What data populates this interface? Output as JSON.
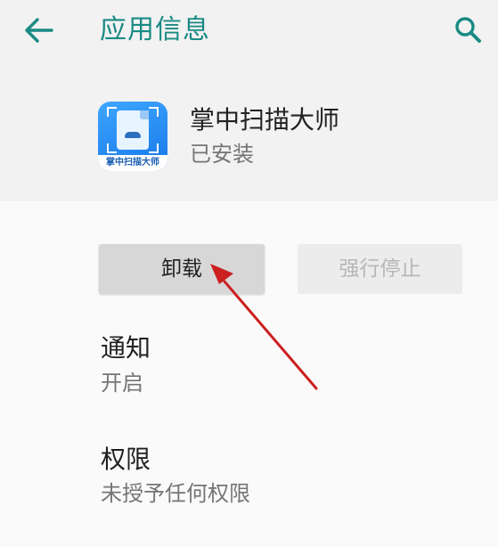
{
  "colors": {
    "accent": "#1a8a84",
    "annotation_arrow": "#cc1f1f"
  },
  "app_bar": {
    "back_icon": "arrow-left-icon",
    "title": "应用信息",
    "search_icon": "search-icon"
  },
  "app": {
    "name": "掌中扫描大师",
    "status": "已安装",
    "icon_caption": "掌中扫描大师"
  },
  "actions": {
    "uninstall_label": "卸载",
    "force_stop_label": "强行停止"
  },
  "settings": {
    "notifications": {
      "title": "通知",
      "value": "开启"
    },
    "permissions": {
      "title": "权限",
      "value": "未授予任何权限"
    }
  }
}
